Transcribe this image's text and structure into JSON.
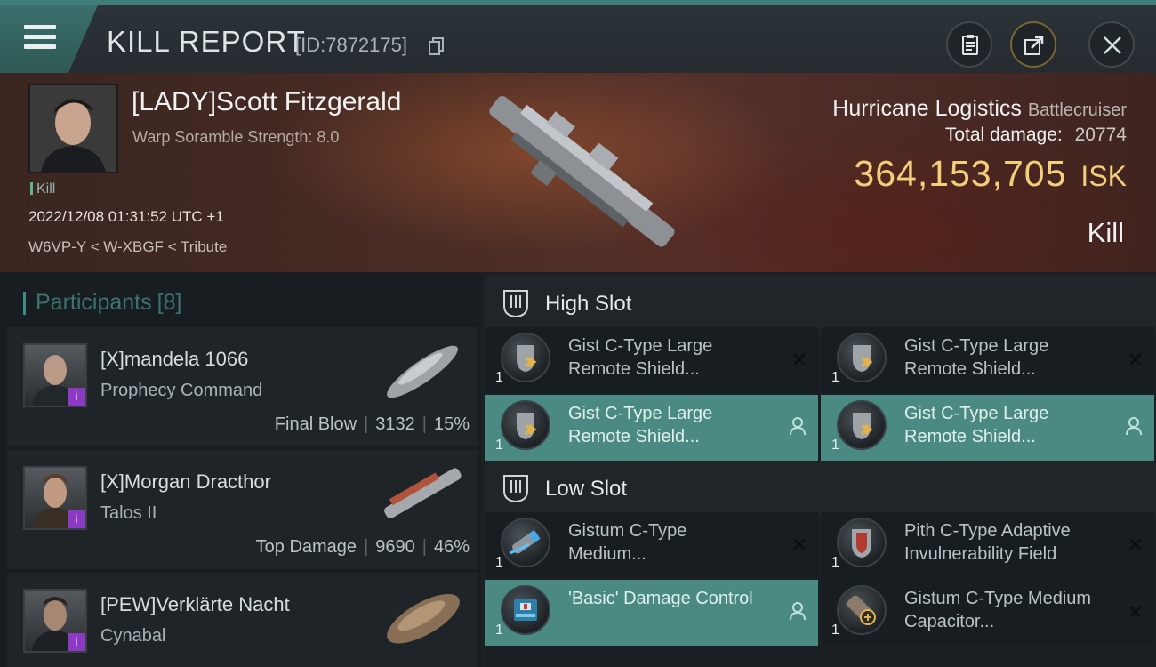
{
  "header": {
    "title": "KILL REPORT",
    "report_id": "[ID:7872175]"
  },
  "victim": {
    "name": "[LADY]Scott Fitzgerald",
    "warp_scramble": "Warp Soramble Strength: 8.0",
    "kill_tag": "Kill",
    "timestamp": "2022/12/08 01:31:52 UTC +1",
    "location": "W6VP-Y < W-XBGF < Tribute",
    "ship": "Hurricane Logistics",
    "ship_class": "Battlecruiser",
    "total_damage_label": "Total damage:",
    "total_damage": "20774",
    "isk_amount": "364,153,705",
    "isk_unit": "ISK",
    "kill_type": "Kill"
  },
  "participants": {
    "label": "Participants",
    "count": "[8]",
    "rows": [
      {
        "name": "[X]mandela 1066",
        "ship": "Prophecy Command",
        "role": "Final Blow",
        "damage": "3132",
        "percent": "15%"
      },
      {
        "name": "[X]Morgan Dracthor",
        "ship": "Talos II",
        "role": "Top Damage",
        "damage": "9690",
        "percent": "46%"
      },
      {
        "name": "[PEW]Verklärte Nacht",
        "ship": "Cynabal",
        "role": "",
        "damage": "",
        "percent": ""
      }
    ]
  },
  "slots": {
    "high": {
      "label": "High Slot",
      "modules": [
        {
          "name": "Gist C-Type Large Remote Shield...",
          "qty": "1",
          "active": false
        },
        {
          "name": "Gist C-Type Large Remote Shield...",
          "qty": "1",
          "active": false
        },
        {
          "name": "Gist C-Type Large Remote Shield...",
          "qty": "1",
          "active": true
        },
        {
          "name": "Gist C-Type Large Remote Shield...",
          "qty": "1",
          "active": true
        }
      ]
    },
    "low": {
      "label": "Low Slot",
      "modules": [
        {
          "name": "Gistum C-Type Medium...",
          "qty": "1",
          "active": false
        },
        {
          "name": "Pith C-Type Adaptive Invulnerability Field",
          "qty": "1",
          "active": false
        },
        {
          "name": "'Basic' Damage Control",
          "qty": "1",
          "active": true
        },
        {
          "name": "Gistum C-Type Medium Capacitor...",
          "qty": "1",
          "active": false
        }
      ]
    }
  },
  "icons": {
    "menu": "menu-icon",
    "copy": "copy-icon",
    "clipboard": "clipboard-icon",
    "share": "share-icon",
    "close": "close-icon",
    "slot": "slot-icon",
    "remove": "remove-icon",
    "user": "user-icon"
  },
  "colors": {
    "accent": "#3f7d78",
    "isk": "#f3cf7b",
    "active_row": "#4b8a83",
    "badge": "#8c3ac4"
  }
}
